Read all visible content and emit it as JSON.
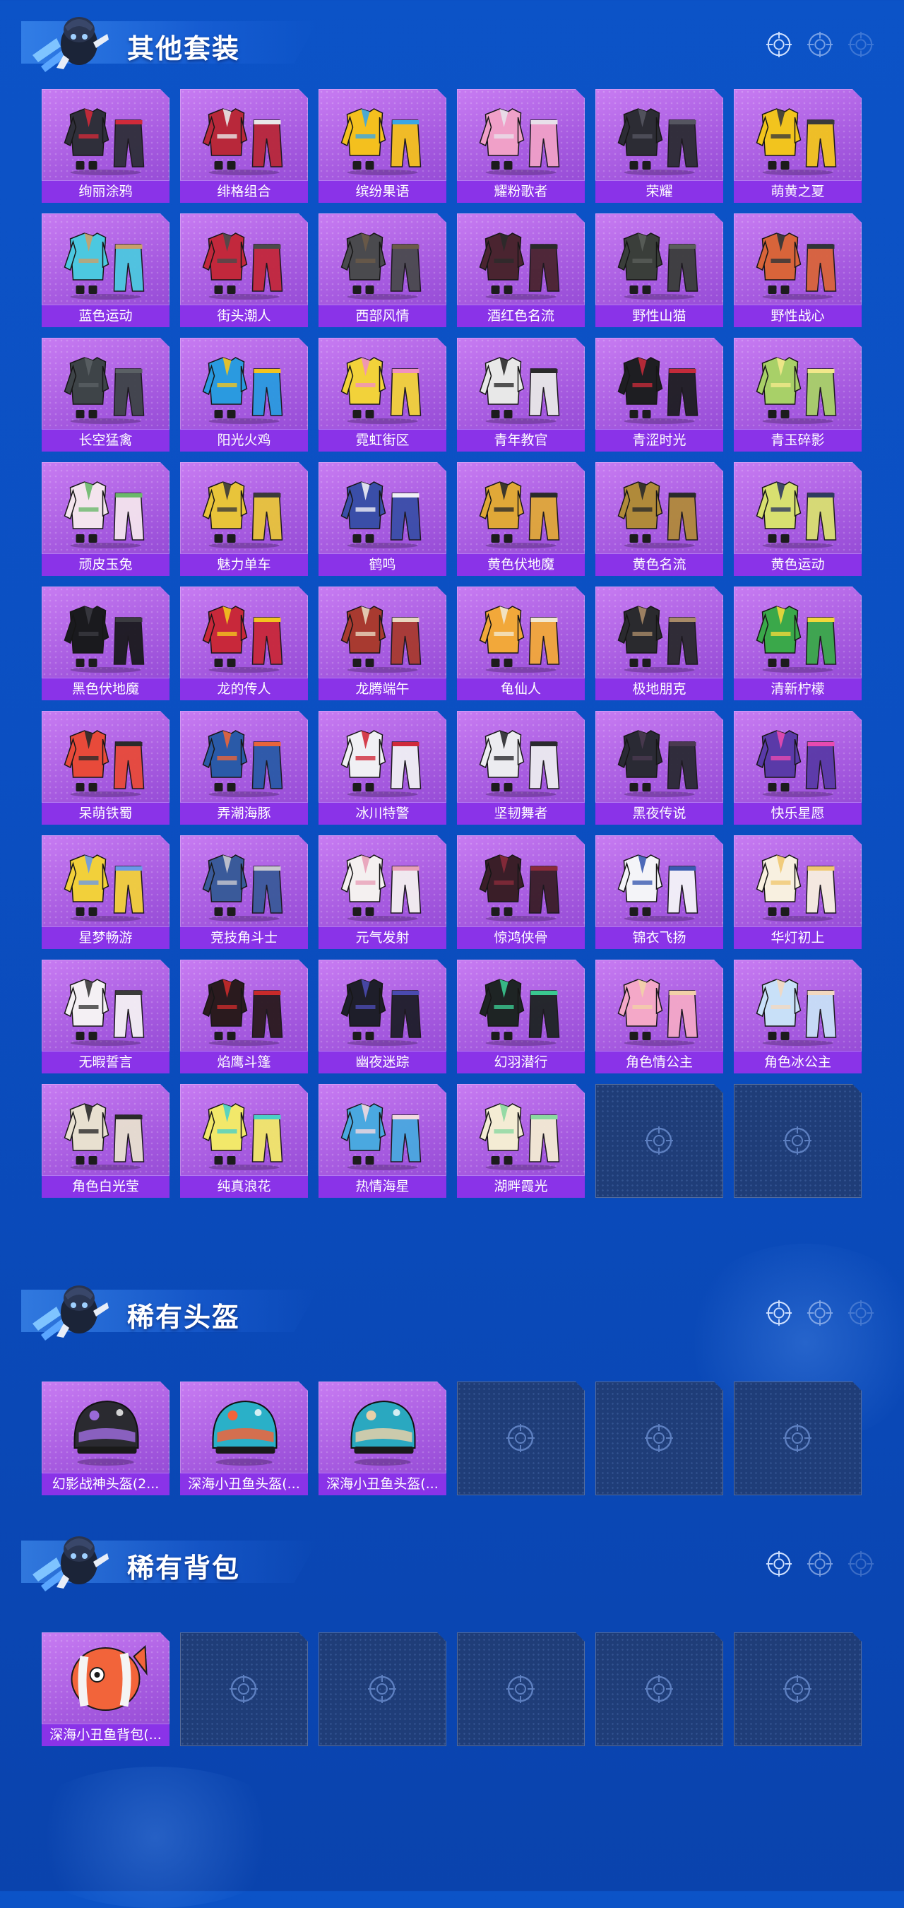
{
  "sections": [
    {
      "title": "其他套装",
      "items": [
        {
          "label": "绚丽涂鸦",
          "color": "#2f2f3a",
          "accent": "#d02a3a"
        },
        {
          "label": "绯格组合",
          "color": "#b8283a",
          "accent": "#e8e8e8"
        },
        {
          "label": "缤纷果语",
          "color": "#f4c01e",
          "accent": "#3aa6e6"
        },
        {
          "label": "耀粉歌者",
          "color": "#f0a0c8",
          "accent": "#e8e0ea"
        },
        {
          "label": "荣耀",
          "color": "#2c2c34",
          "accent": "#555560"
        },
        {
          "label": "萌黄之夏",
          "color": "#f2c41e",
          "accent": "#3a3a3a"
        },
        {
          "label": "蓝色运动",
          "color": "#4cc8e0",
          "accent": "#c9a06a"
        },
        {
          "label": "街头潮人",
          "color": "#c2283c",
          "accent": "#4a4a4a"
        },
        {
          "label": "西部风情",
          "color": "#4a4a4e",
          "accent": "#6b5a48"
        },
        {
          "label": "酒红色名流",
          "color": "#4a2430",
          "accent": "#2a2a2a"
        },
        {
          "label": "野性山猫",
          "color": "#3a3e3a",
          "accent": "#5a5e5a"
        },
        {
          "label": "野性战心",
          "color": "#d8643a",
          "accent": "#2f3438"
        },
        {
          "label": "长空猛禽",
          "color": "#3e4448",
          "accent": "#5a6064"
        },
        {
          "label": "阳光火鸡",
          "color": "#2a9ae0",
          "accent": "#f2c41e"
        },
        {
          "label": "霓虹街区",
          "color": "#f2d23a",
          "accent": "#f090c0"
        },
        {
          "label": "青年教官",
          "color": "#e8e8e8",
          "accent": "#2a2a2a"
        },
        {
          "label": "青涩时光",
          "color": "#1e1e22",
          "accent": "#c42a3a"
        },
        {
          "label": "青玉碎影",
          "color": "#a8d068",
          "accent": "#f2e88a"
        },
        {
          "label": "顽皮玉兔",
          "color": "#f4e4ee",
          "accent": "#6ab86a"
        },
        {
          "label": "魅力单车",
          "color": "#e8c43a",
          "accent": "#3a3a3a"
        },
        {
          "label": "鹤鸣",
          "color": "#3a4ea8",
          "accent": "#f0f0f6"
        },
        {
          "label": "黄色伏地魔",
          "color": "#e0a838",
          "accent": "#2a2a2a"
        },
        {
          "label": "黄色名流",
          "color": "#b08a3a",
          "accent": "#2a2a2a"
        },
        {
          "label": "黄色运动",
          "color": "#d8e070",
          "accent": "#2f3a60"
        },
        {
          "label": "黑色伏地魔",
          "color": "#1a1a1e",
          "accent": "#3a3a40"
        },
        {
          "label": "龙的传人",
          "color": "#c8283a",
          "accent": "#f2c41e"
        },
        {
          "label": "龙腾端午",
          "color": "#a83a30",
          "accent": "#e8d8c0"
        },
        {
          "label": "龟仙人",
          "color": "#f2a83a",
          "accent": "#f2e8d0"
        },
        {
          "label": "极地朋克",
          "color": "#2a2a2e",
          "accent": "#a88a68"
        },
        {
          "label": "清新柠檬",
          "color": "#3aa84a",
          "accent": "#f2d83a"
        },
        {
          "label": "呆萌铁蜀",
          "color": "#e84a3a",
          "accent": "#2a2a2a"
        },
        {
          "label": "弄潮海豚",
          "color": "#2a5aa8",
          "accent": "#e8643a"
        },
        {
          "label": "冰川特警",
          "color": "#f0f0f4",
          "accent": "#d02a3a"
        },
        {
          "label": "坚韧舞者",
          "color": "#ececf0",
          "accent": "#2a2a2e"
        },
        {
          "label": "黑夜传说",
          "color": "#2a2a34",
          "accent": "#4a3a50"
        },
        {
          "label": "快乐星愿",
          "color": "#5a3aa8",
          "accent": "#e84ab0"
        },
        {
          "label": "星梦畅游",
          "color": "#f2d03a",
          "accent": "#6a9ae8"
        },
        {
          "label": "竞技角斗士",
          "color": "#3a5a9a",
          "accent": "#c8c8d0"
        },
        {
          "label": "元气发射",
          "color": "#f4f0f0",
          "accent": "#e8a0b8"
        },
        {
          "label": "惊鸿侠骨",
          "color": "#3a1e28",
          "accent": "#8a2a3a"
        },
        {
          "label": "锦衣飞扬",
          "color": "#f4f4f8",
          "accent": "#3a5ab0"
        },
        {
          "label": "华灯初上",
          "color": "#f8f0e0",
          "accent": "#f0c870"
        },
        {
          "label": "无暇誓言",
          "color": "#f4f0f4",
          "accent": "#3a3a3a"
        },
        {
          "label": "焰鹰斗篷",
          "color": "#2a1a1e",
          "accent": "#c82a2a"
        },
        {
          "label": "幽夜迷踪",
          "color": "#1e1e2a",
          "accent": "#4a4ab0"
        },
        {
          "label": "幻羽潜行",
          "color": "#1e2424",
          "accent": "#3ac890"
        },
        {
          "label": "角色情公主",
          "color": "#f4a8c8",
          "accent": "#f2d0a8"
        },
        {
          "label": "角色冰公主",
          "color": "#c8e0f8",
          "accent": "#f2d8c0"
        },
        {
          "label": "角色白光莹",
          "color": "#e8e0d0",
          "accent": "#2a2a2a"
        },
        {
          "label": "纯真浪花",
          "color": "#f2e86a",
          "accent": "#4ad0c8"
        },
        {
          "label": "热情海星",
          "color": "#4aa8e0",
          "accent": "#f2d8e0"
        },
        {
          "label": "湖畔霞光",
          "color": "#f4ecd4",
          "accent": "#8ad8a0"
        },
        {
          "empty": true
        },
        {
          "empty": true
        }
      ]
    },
    {
      "title": "稀有头盔",
      "items": [
        {
          "label": "幻影战神头盔(2...",
          "color": "#2a2a30",
          "accent": "#9a6ad8",
          "kind": "helmet"
        },
        {
          "label": "深海小丑鱼头盔(...",
          "color": "#2ab0c8",
          "accent": "#f2643a",
          "kind": "helmet"
        },
        {
          "label": "深海小丑鱼头盔(...",
          "color": "#2aa8c0",
          "accent": "#e8d0a8",
          "kind": "helmet"
        },
        {
          "empty": true
        },
        {
          "empty": true
        },
        {
          "empty": true
        }
      ]
    },
    {
      "title": "稀有背包",
      "items": [
        {
          "label": "深海小丑鱼背包(...",
          "color": "#f2643a",
          "accent": "#f4f4f4",
          "kind": "backpack"
        },
        {
          "empty": true
        },
        {
          "empty": true
        },
        {
          "empty": true
        },
        {
          "empty": true
        },
        {
          "empty": true
        }
      ]
    }
  ]
}
